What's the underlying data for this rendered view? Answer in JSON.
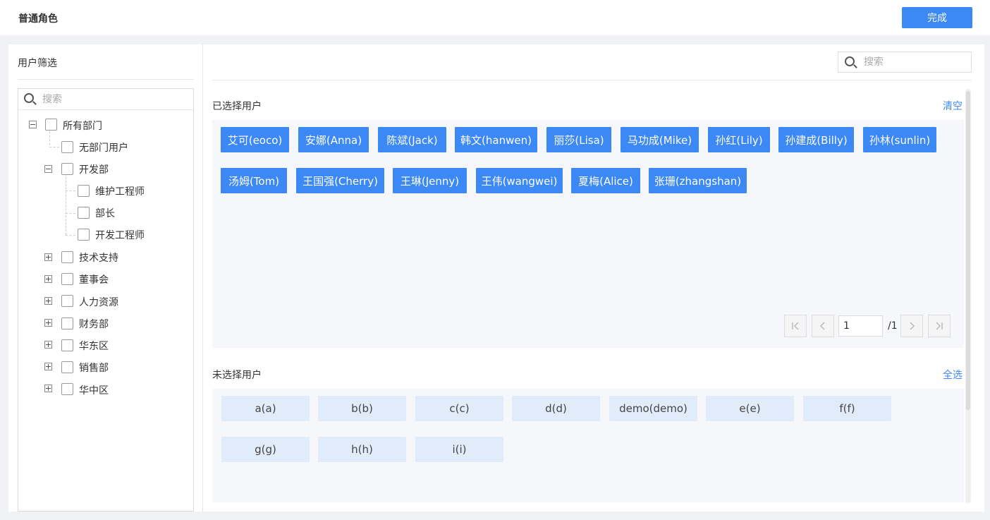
{
  "header": {
    "title": "普通角色",
    "done_label": "完成"
  },
  "filter": {
    "title": "用户筛选",
    "search_placeholder": "搜索",
    "tree": {
      "root": "所有部门",
      "no_dept": "无部门用户",
      "dev": "开发部",
      "dev_children": [
        "维护工程师",
        "部长",
        "开发工程师"
      ],
      "collapsed": [
        "技术支持",
        "董事会",
        "人力资源",
        "财务部",
        "华东区",
        "销售部",
        "华中区"
      ]
    }
  },
  "search": {
    "placeholder": "搜索"
  },
  "selected": {
    "title": "已选择用户",
    "action": "清空",
    "users": [
      "艾可(eoco)",
      "安娜(Anna)",
      "陈斌(Jack)",
      "韩文(hanwen)",
      "丽莎(Lisa)",
      "马功成(Mike)",
      "孙红(Lily)",
      "孙建成(Billy)",
      "孙林(sunlin)",
      "汤姆(Tom)",
      "王国强(Cherry)",
      "王琳(Jenny)",
      "王伟(wangwei)",
      "夏梅(Alice)",
      "张珊(zhangshan)"
    ],
    "pagination": {
      "page": "1",
      "total": "/1"
    }
  },
  "unselected": {
    "title": "未选择用户",
    "action": "全选",
    "users": [
      "a(a)",
      "b(b)",
      "c(c)",
      "d(d)",
      "demo(demo)",
      "e(e)",
      "f(f)",
      "g(g)",
      "h(h)",
      "i(i)"
    ]
  }
}
